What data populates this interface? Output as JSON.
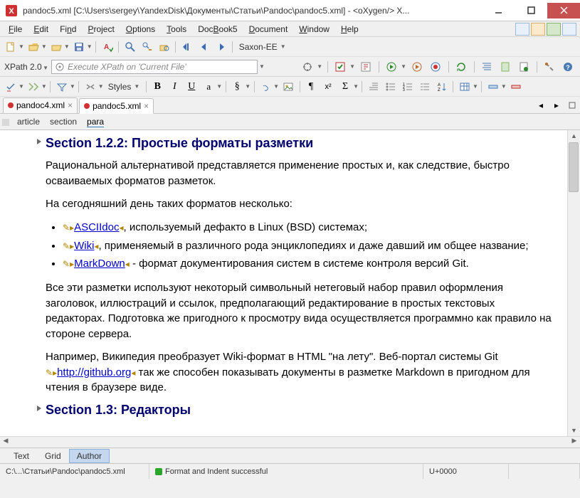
{
  "window": {
    "title": "pandoc5.xml [C:\\Users\\sergey\\YandexDisk\\Документы\\Статьи\\Pandoc\\pandoc5.xml] - <oXygen/> X..."
  },
  "menus": {
    "file": "File",
    "edit": "Edit",
    "find": "Find",
    "project": "Project",
    "options": "Options",
    "tools": "Tools",
    "docbook5": "DocBook5",
    "document": "Document",
    "window": "Window",
    "help": "Help"
  },
  "xpath": {
    "label": "XPath 2.0",
    "placeholder": "Execute XPath on 'Current File'"
  },
  "transform": {
    "engine": "Saxon-EE"
  },
  "styles": {
    "label": "Styles"
  },
  "tabs": [
    {
      "name": "pandoc4.xml",
      "dirty": true,
      "active": false
    },
    {
      "name": "pandoc5.xml",
      "dirty": true,
      "active": true
    }
  ],
  "breadcrumb": {
    "items": [
      "article",
      "section",
      "para"
    ],
    "active_index": 2
  },
  "document": {
    "h1": "Section 1.2.2: Простые форматы разметки",
    "p1": " Рациональной альтернативой представляется применение простых и, как следствие, быстро осваиваемых форматов разметок.",
    "p2": " На сегодняшний день таких форматов несколько:",
    "li1_link": "ASCIIdoc",
    "li1_rest": ", используемый дефакто в Linux (BSD) системах;",
    "li2_link": "Wiki",
    "li2_rest": ", применяемый в различного рода энциклопедиях и даже давший им общее название;",
    "li3_link": "MarkDown",
    "li3_rest": " - формат документирования систем в системе контроля версий Git.",
    "p3": " Все эти разметки используют некоторый символьный нетеговый набор правил оформления заголовок, иллюстраций и ссылок, предполагающий редактирование в простых текстовых редакторах. Подготовка же пригодного к просмотру вида осуществляется программно как правило на стороне сервера.",
    "p4a": " Например, Википедия преобразует Wiki-формат в HTML \"на лету\". Веб-портал системы Git ",
    "p4_link": "http://github.org",
    "p4b": " так же способен показывать документы в разметке Markdown в пригодном для чтения в браузере виде.",
    "h2": "Section 1.3: Редакторы"
  },
  "modes": {
    "text": "Text",
    "grid": "Grid",
    "author": "Author",
    "active": "author"
  },
  "status": {
    "path": "C:\\...\\Статьи\\Pandoc\\pandoc5.xml",
    "message": "Format and Indent successful",
    "unicode": "U+0000"
  },
  "icons": {
    "pencil": "✎",
    "triangle_left": "◂",
    "triangle_right": "▸"
  }
}
